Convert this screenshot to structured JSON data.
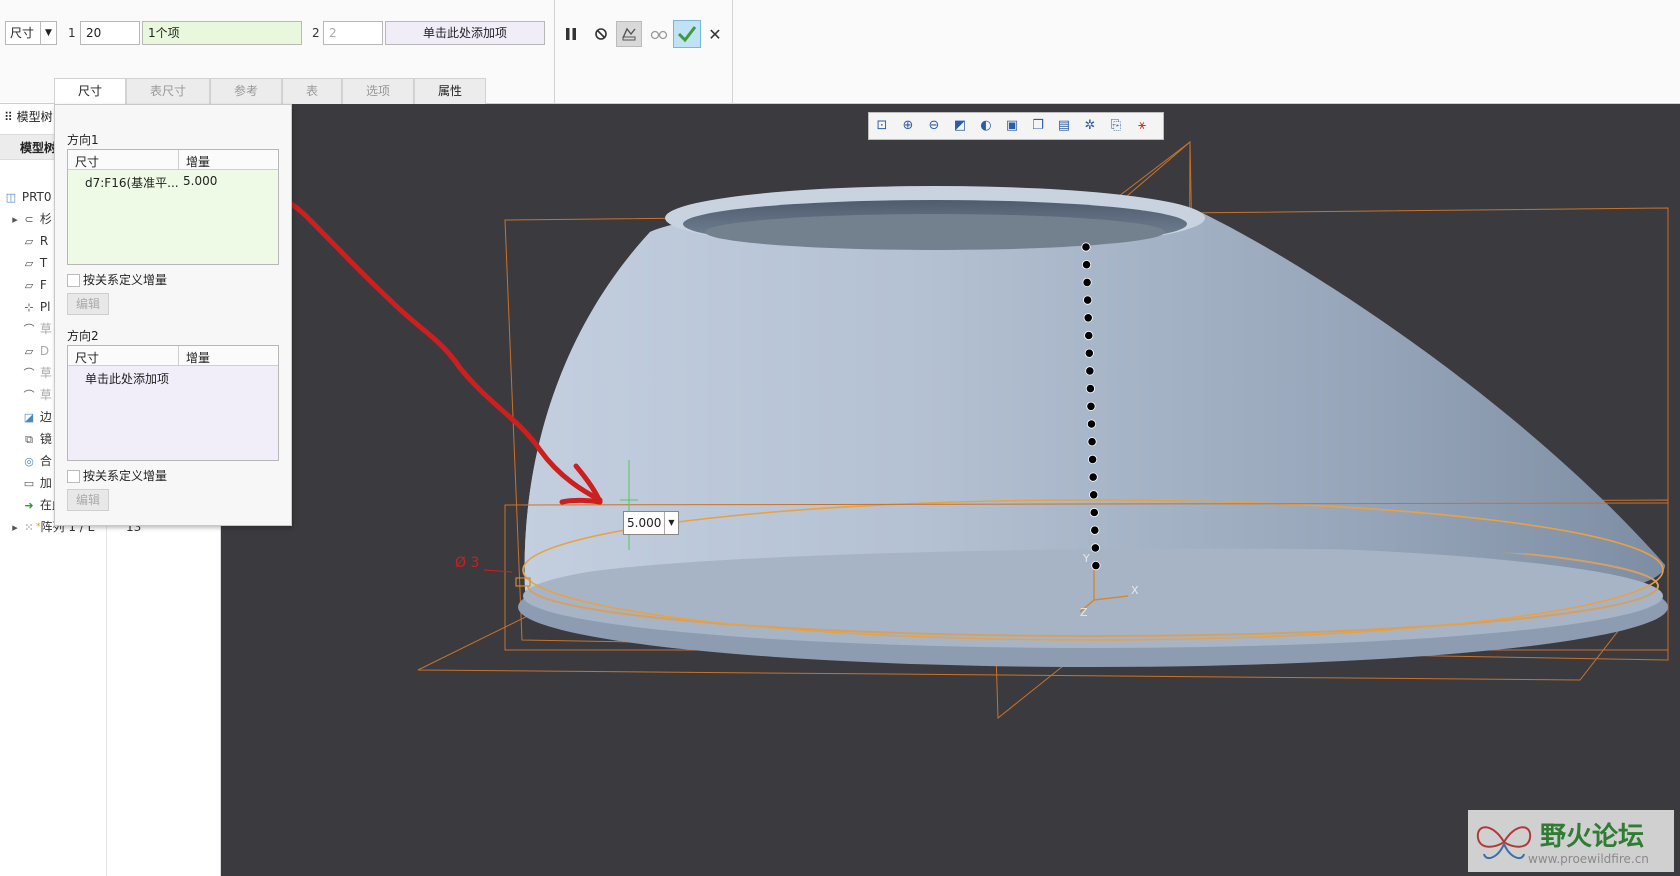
{
  "ribbon": {
    "type_select": "尺寸",
    "dir1_label": "1",
    "dir1_count": "20",
    "dir1_items": "1个项",
    "dir2_label": "2",
    "dir2_count": "2",
    "dir2_add": "单击此处添加项",
    "tabs": [
      "尺寸",
      "表尺寸",
      "参考",
      "表",
      "选项",
      "属性"
    ]
  },
  "tree": {
    "header_short": "模型树",
    "header_short2": "模型树",
    "rows": [
      {
        "label": "PRT0",
        "icon": "part-icon"
      },
      {
        "label": "杉",
        "icon": "layer-icon"
      },
      {
        "label": "R",
        "icon": "plane-icon"
      },
      {
        "label": "T",
        "icon": "plane-icon"
      },
      {
        "label": "F",
        "icon": "plane-icon"
      },
      {
        "label": "Pl",
        "icon": "csys-icon"
      },
      {
        "label": "草",
        "icon": "sketch-icon"
      },
      {
        "label": "D",
        "icon": "plane-icon"
      },
      {
        "label": "草",
        "icon": "sketch-icon"
      },
      {
        "label": "草",
        "icon": "sketch-icon"
      },
      {
        "label": "边",
        "icon": "boundary-icon"
      },
      {
        "label": "镜",
        "icon": "mirror-icon"
      },
      {
        "label": "合",
        "icon": "merge-icon"
      },
      {
        "label": "加",
        "icon": "thicken-icon"
      },
      {
        "label": "在此插入",
        "icon": "insert-arrow-icon"
      },
      {
        "label": "阵列 1 / L",
        "icon": "pattern-icon",
        "extra": "13"
      }
    ]
  },
  "panel": {
    "dir1_title": "方向1",
    "dir2_title": "方向2",
    "col_dim": "尺寸",
    "col_inc": "增量",
    "dir1_row_dim": "d7:F16(基准平...",
    "dir1_row_inc": "5.000",
    "dir2_placeholder": "单击此处添加项",
    "relation_checkbox": "按关系定义增量",
    "edit_button": "编辑"
  },
  "viewport": {
    "dim_value": "5.000",
    "dim_label_red": "Ø 3",
    "axis_x": "X",
    "axis_y": "Y",
    "axis_z": "Z",
    "dot_count": 19
  },
  "watermark": {
    "title": "野火论坛",
    "url": "www.proewildfire.cn"
  },
  "colors": {
    "accent_green": "#3f9c35",
    "surface": "#a9b6c8",
    "frame_orange": "#c7722c",
    "arrow_red": "#cc1f1f"
  }
}
